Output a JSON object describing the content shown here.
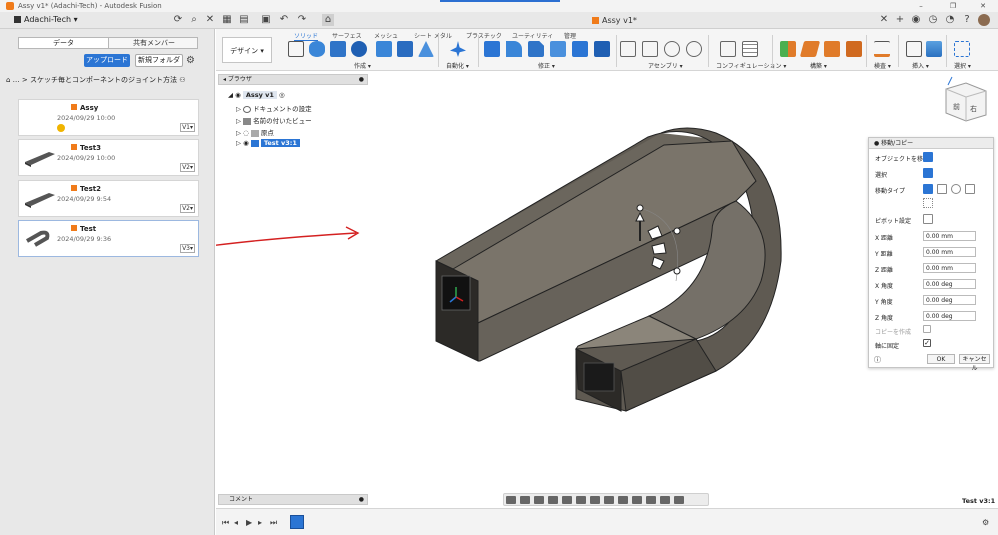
{
  "window": {
    "title": "Assy v1* (Adachi-Tech) - Autodesk Fusion",
    "controls": [
      "–",
      "❐",
      "✕"
    ]
  },
  "tabbar": {
    "team": "Adachi-Tech",
    "document_tab": "Assy v1*"
  },
  "data_panel": {
    "tabs": [
      "データ",
      "共有メンバー"
    ],
    "upload_label": "アップロード",
    "new_folder_label": "新規フォルダ",
    "breadcrumb": "… > スケッチ毎とコンポーネントのジョイント方法",
    "files": [
      {
        "name": "Assy",
        "date": "2024/09/29 10:00",
        "version": "V1▾"
      },
      {
        "name": "Test3",
        "date": "2024/09/29 10:00",
        "version": "V2▾"
      },
      {
        "name": "Test2",
        "date": "2024/09/29 9:54",
        "version": "V2▾"
      },
      {
        "name": "Test",
        "date": "2024/09/29 9:36",
        "version": "V3▾"
      }
    ]
  },
  "toolbar": {
    "workspace": "デザイン ▾",
    "tabs": [
      "ソリッド",
      "サーフェス",
      "メッシュ",
      "シート メタル",
      "プラスチック",
      "ユーティリティ",
      "管理"
    ],
    "groups": [
      "作成 ▾",
      "自動化 ▾",
      "修正 ▾",
      "アセンブリ ▾",
      "コンフィギュレーション ▾",
      "構築 ▾",
      "検査 ▾",
      "挿入 ▾",
      "選択 ▾"
    ]
  },
  "browser": {
    "title": "ブラウザ",
    "root": "Assy v1",
    "items": [
      "ドキュメントの設定",
      "名前の付いたビュー",
      "原点",
      "Test v3:1"
    ]
  },
  "move_dialog": {
    "title": "移動/コピー",
    "rows": [
      {
        "label": "オブジェクトを移動"
      },
      {
        "label": "選択"
      },
      {
        "label": "移動タイプ"
      },
      {
        "label": "ピボット設定"
      },
      {
        "label": "X 距離",
        "value": "0.00 mm"
      },
      {
        "label": "Y 距離",
        "value": "0.00 mm"
      },
      {
        "label": "Z 距離",
        "value": "0.00 mm"
      },
      {
        "label": "X 角度",
        "value": "0.00 deg"
      },
      {
        "label": "Y 角度",
        "value": "0.00 deg"
      },
      {
        "label": "Z 角度",
        "value": "0.00 deg"
      },
      {
        "label": "コピーを作成"
      },
      {
        "label": "軸に固定"
      }
    ],
    "ok_label": "OK",
    "cancel_label": "キャンセル"
  },
  "viewcube": {
    "front": "前",
    "right": "右"
  },
  "status": {
    "comment_label": "コメント",
    "selection": "Test v3:1"
  },
  "colors": {
    "accent": "#2b75d4",
    "cube_icon": "#f07b1a",
    "part_body": "#5f5a52",
    "annotation_red": "#d42020"
  }
}
